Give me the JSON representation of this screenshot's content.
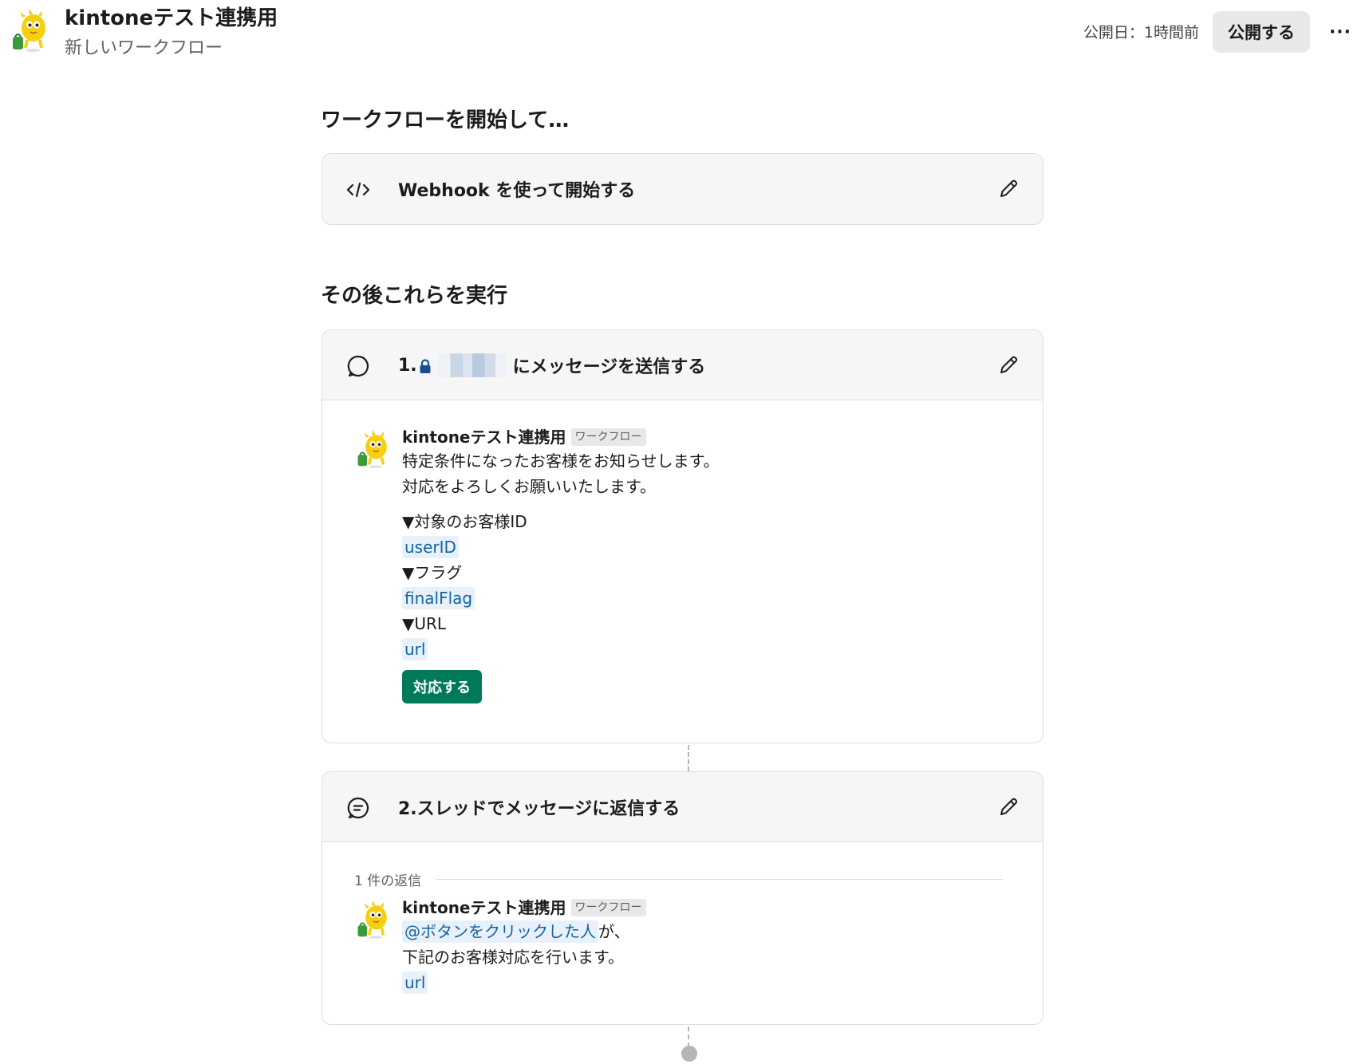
{
  "header": {
    "app_name": "kintoneテスト連携用",
    "workflow_name": "新しいワークフロー",
    "published_label": "公開日：1時間前",
    "publish_button": "公開する",
    "more_icon": "more-horizontal-icon"
  },
  "trigger_section": {
    "heading": "ワークフローを開始して…",
    "card": {
      "icon": "code-icon",
      "title": "Webhook を使って開始する",
      "edit_icon": "pencil-icon"
    }
  },
  "steps_section": {
    "heading": "その後これらを実行",
    "steps": [
      {
        "icon": "message-bubble-icon",
        "title_prefix": "1.",
        "title_suffix": "にメッセージを送信する",
        "edit_icon": "pencil-icon",
        "preview": {
          "sender": "kintoneテスト連携用",
          "tag": "ワークフロー",
          "lines": [
            "特定条件になったお客様をお知らせします。",
            "対応をよろしくお願いいたします。"
          ],
          "label_customer": "▼対象のお客様ID",
          "var_user": "userID",
          "label_flag": "▼フラグ",
          "var_flag": "finalFlag",
          "label_url": "▼URL",
          "var_url": "url",
          "button": "対応する"
        }
      },
      {
        "icon": "thread-reply-icon",
        "title": "2.スレッドでメッセージに返信する",
        "edit_icon": "pencil-icon",
        "preview": {
          "reply_count": "1 件の返信",
          "sender": "kintoneテスト連携用",
          "tag": "ワークフロー",
          "mention": "@ボタンをクリックした人",
          "mention_suffix": "が、",
          "line2": "下記のお客様対応を行います。",
          "var_url": "url"
        }
      }
    ]
  },
  "colors": {
    "accent_green": "#007a5a",
    "variable_blue": "#1264a3",
    "variable_bg": "#e8f1fa",
    "card_header_bg": "#f6f6f6",
    "lock_blue": "#1a4d8f"
  }
}
